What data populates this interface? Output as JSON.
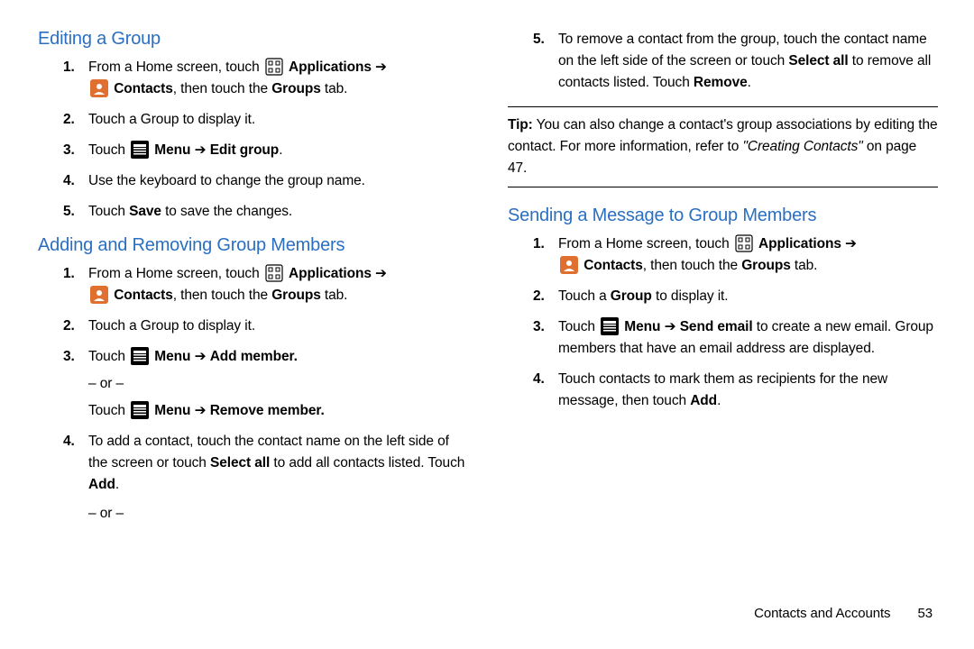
{
  "left": {
    "h1": "Editing a Group",
    "edit_steps": {
      "s1a": "From a Home screen, touch ",
      "s1_app": "Applications",
      "s1b": "Contacts",
      "s1c": ", then touch the ",
      "s1_groups": "Groups",
      "s1d": " tab.",
      "s2": "Touch a Group to display it.",
      "s3a": "Touch ",
      "s3_menu": "Menu",
      "s3_arrow": " ➔ ",
      "s3_edit": "Edit group",
      "s3b": ".",
      "s4": "Use the keyboard to change the group name.",
      "s5a": "Touch ",
      "s5_save": "Save",
      "s5b": " to save the changes."
    },
    "h2": "Adding and Removing Group Members",
    "addrem": {
      "s1a": "From a Home screen, touch ",
      "s1_app": "Applications",
      "s1b": "Contacts",
      "s1c": ", then touch the ",
      "s1_groups": "Groups",
      "s1d": " tab.",
      "s2": "Touch a Group to display it.",
      "s3a": "Touch ",
      "s3_menu": "Menu",
      "s3_arrow": " ➔ ",
      "s3_add": "Add member.",
      "or": "– or –",
      "s3b_touch": "Touch ",
      "s3b_menu": "Menu",
      "s3b_arrow": " ➔ ",
      "s3b_remove": "Remove member.",
      "s4a": "To add a contact, touch the contact name on the left side of the screen or touch ",
      "s4_sel": "Select all",
      "s4b": " to add all contacts listed. Touch ",
      "s4_add": "Add",
      "s4c": ".",
      "or2": "– or –"
    }
  },
  "right": {
    "cont5a": "To remove a contact from the group, touch the contact name on the left side of the screen or touch ",
    "cont5_sel": "Select all",
    "cont5b": " to remove all contacts listed. Touch ",
    "cont5_rem": "Remove",
    "cont5c": ".",
    "tip_label": "Tip:",
    "tip_body": " You can also change a contact's group associations by editing the contact. For more information, refer to ",
    "tip_ref": "\"Creating Contacts\"",
    "tip_ref2": " on page 47.",
    "h1": "Sending a Message to Group Members",
    "send": {
      "s1a": "From a Home screen, touch ",
      "s1_app": "Applications",
      "s1b": "Contacts",
      "s1c": ", then touch the ",
      "s1_groups": "Groups",
      "s1d": " tab.",
      "s2a": "Touch a ",
      "s2_group": "Group",
      "s2b": " to display it.",
      "s3a": "Touch ",
      "s3_menu": "Menu",
      "s3_arrow": " ➔ ",
      "s3_send": "Send email",
      "s3b": " to create a new email. Group members that have an email address are displayed.",
      "s4a": "Touch contacts to mark them as recipients for the new message, then touch ",
      "s4_add": "Add",
      "s4b": "."
    }
  },
  "footer": {
    "section": "Contacts and Accounts",
    "page": "53"
  }
}
